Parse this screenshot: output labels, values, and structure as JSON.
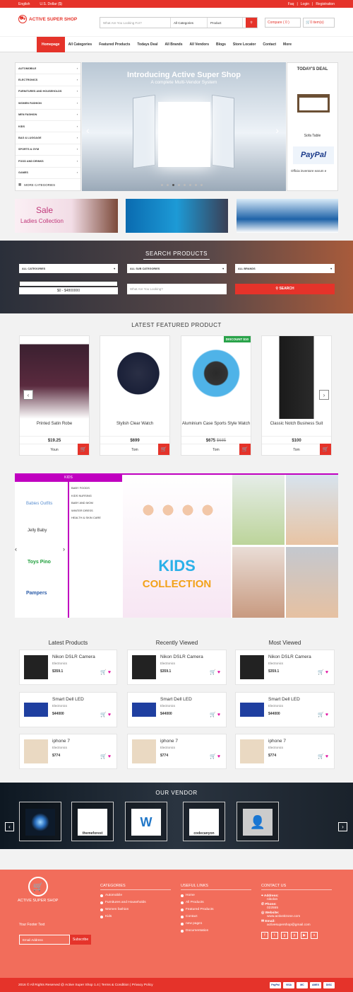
{
  "topbar": {
    "language": "English",
    "currency": "U.S. Dollar ($)",
    "faq": "Faq",
    "login": "Login",
    "registration": "Registration"
  },
  "header": {
    "logo_text": "ACTIVE SUPER SHOP",
    "search_placeholder": "What Are You Looking For?",
    "category_select": "All Categories",
    "type_select": "Product",
    "compare": "Compare ( 0 )",
    "cart": "0 item(s)"
  },
  "nav": {
    "items": [
      "Homepage",
      "All Categories",
      "Featured Products",
      "Todays Deal",
      "All Brands",
      "All Vendors",
      "Blogs",
      "Store Locator",
      "Contact",
      "More"
    ]
  },
  "categories": {
    "items": [
      "AUTOMOBILE",
      "ELECTRONICS",
      "FURNITURES AND HOUSEHOLDS",
      "WOMEN FASHION",
      "MEN FASHION",
      "KIDS",
      "BAG & LUGGAGE",
      "SPORTS & GYM",
      "FOOD AND DRINKS",
      "GAMES"
    ],
    "more": "MORE CATEGORIES"
  },
  "slider": {
    "title": "Introducing Active Super Shop",
    "subtitle": "A complete Multi-Vendor System"
  },
  "deal": {
    "heading": "TODAY'S DEAL",
    "item1": "Sofa Table",
    "item2": "Officia inventore earum e",
    "paypal": "PayPal"
  },
  "banners": {
    "sale": "Sale",
    "sale_sub": "Ladies Collection"
  },
  "search_products": {
    "title": "SEARCH PRODUCTS",
    "cat": "ALL CATEGORIES",
    "subcat": "ALL SUB CATEGORIES",
    "brand": "ALL BRANDS",
    "range": "$0 - $4800000",
    "placeholder": "What Are You Looking?",
    "button": "SEARCH"
  },
  "featured": {
    "title": "LATEST FEATURED PRODUCT",
    "products": [
      {
        "name": "Printed Satin Robe",
        "price": "$19.25",
        "old": "",
        "vendor": "Youn",
        "badge": ""
      },
      {
        "name": "Stylish Clear Watch",
        "price": "$699",
        "old": "",
        "vendor": "Tom",
        "badge": ""
      },
      {
        "name": "Aluminium Case Sports Style Watch",
        "price": "$675",
        "old": "$685",
        "vendor": "Tom",
        "badge": "DISCOUNT $10"
      },
      {
        "name": "Classic Notch Business Suit",
        "price": "$100",
        "old": "",
        "vendor": "Tom",
        "badge": ""
      }
    ]
  },
  "kids": {
    "tab": "KIDS",
    "links": [
      "BABY FOODS",
      "KIDS NURSING",
      "BABY AND MOM",
      "WINTER DRESS",
      "HEALTH & SKIN CARE"
    ],
    "brands": [
      "Babies Outfits",
      "Jelly Baby",
      "Toys Pino",
      "Pampers"
    ],
    "collection1": "KIDS",
    "collection2": "COLLECTION"
  },
  "lists": {
    "columns": [
      {
        "title": "Latest Products",
        "items": [
          {
            "name": "Nikon DSLR Camera",
            "cat": "Electronics",
            "price": "$359.1"
          },
          {
            "name": "Smart Dell LED",
            "cat": "Electronics",
            "price": "$44000"
          },
          {
            "name": "iphone 7",
            "cat": "Electronics",
            "price": "$774"
          }
        ]
      },
      {
        "title": "Recently Viewed",
        "items": [
          {
            "name": "Nikon DSLR Camera",
            "cat": "Electronics",
            "price": "$359.1"
          },
          {
            "name": "Smart Dell LED",
            "cat": "Electronics",
            "price": "$44000"
          },
          {
            "name": "iphone 7",
            "cat": "Electronics",
            "price": "$774"
          }
        ]
      },
      {
        "title": "Most Viewed",
        "items": [
          {
            "name": "Nikon DSLR Camera",
            "cat": "Electronics",
            "price": "$359.1"
          },
          {
            "name": "Smart Dell LED",
            "cat": "Electronics",
            "price": "$44000"
          },
          {
            "name": "iphone 7",
            "cat": "Electronics",
            "price": "$774"
          }
        ]
      }
    ]
  },
  "vendor": {
    "title": "OUR VENDOR",
    "names": [
      "themeforest",
      "codecanyon"
    ]
  },
  "footer": {
    "logo": "ACTIVE SUPER SHOP",
    "footer_text": "Your Footer Text",
    "email_placeholder": "Email Address",
    "subscribe": "Subscribe",
    "categories_title": "CATEGORIES",
    "categories": [
      "Automobile",
      "Furnitures and Households",
      "Women fashion",
      "Kids"
    ],
    "links_title": "USEFUL LINKS",
    "links": [
      "Home",
      "All Products",
      "Featured Products",
      "Contact",
      "new page1",
      "Documentation"
    ],
    "contact_title": "CONTACT US",
    "address_label": "Address:",
    "address": "nikolon",
    "phone_label": "Phone:",
    "phone": "022555",
    "website_label": "Website:",
    "website": "www.activeitzone.com",
    "email_label": "Email:",
    "email": "activesupershop@gmail.com"
  },
  "copyright": {
    "text": "2016 © All Rights Reserved @ Active Super Shop 1.4",
    "terms": "Terms & Condition",
    "privacy": "Privacy Policy",
    "payments": [
      "PayPal",
      "VISA",
      "MC",
      "AMEX",
      "DISC"
    ]
  }
}
